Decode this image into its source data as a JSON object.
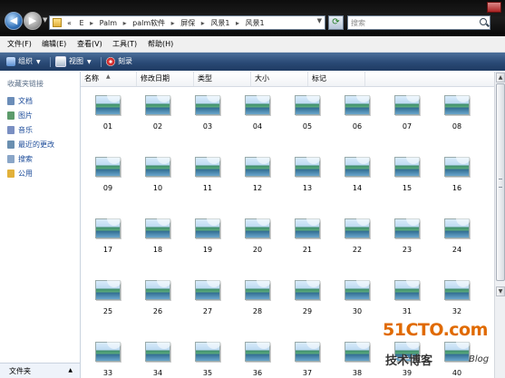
{
  "address_bar": {
    "overflow_chevron": "«",
    "crumbs": [
      "E",
      "Palm",
      "palm软件",
      "屏保",
      "风景1",
      "风景1"
    ],
    "separator": "▸"
  },
  "search": {
    "placeholder": "搜索"
  },
  "menu": [
    "文件(F)",
    "编辑(E)",
    "查看(V)",
    "工具(T)",
    "帮助(H)"
  ],
  "toolbar": {
    "organize": "组织",
    "views": "视图",
    "burn": "刻录"
  },
  "left_pane": {
    "title": "收藏夹链接",
    "links": [
      "文档",
      "图片",
      "音乐",
      "最近的更改",
      "搜索",
      "公用"
    ],
    "footer": "文件夹",
    "footer_icon": "chevron-up-icon"
  },
  "columns": [
    "名称",
    "修改日期",
    "类型",
    "大小",
    "标记"
  ],
  "files": [
    "01",
    "02",
    "03",
    "04",
    "05",
    "06",
    "07",
    "08",
    "09",
    "10",
    "11",
    "12",
    "13",
    "14",
    "15",
    "16",
    "17",
    "18",
    "19",
    "20",
    "21",
    "22",
    "23",
    "24",
    "25",
    "26",
    "27",
    "28",
    "29",
    "30",
    "31",
    "32",
    "33",
    "34",
    "35",
    "36",
    "37",
    "38",
    "39",
    "40"
  ],
  "watermark": {
    "site": "51CTO.com",
    "text": "技术博客",
    "blog": "Blog"
  },
  "colors": {
    "toolbar": "#2a4a76",
    "titlebar": "#111111",
    "link": "#1a4a98",
    "watermark": "#e06a00"
  }
}
